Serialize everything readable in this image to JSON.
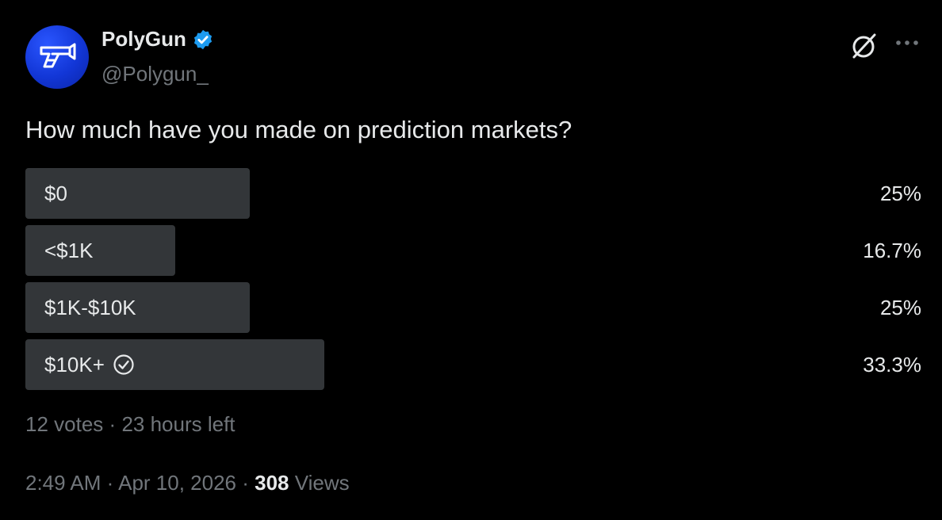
{
  "author": {
    "display_name": "PolyGun",
    "handle": "@Polygun_",
    "verified_icon": "verified-badge-icon",
    "avatar_icon": "polygun-logo",
    "avatar_color": "#1d3fe0"
  },
  "header_actions": {
    "grok_icon": "grok-icon",
    "more_icon": "more-horizontal-icon"
  },
  "post": {
    "question": "How much have you made on prediction markets?"
  },
  "poll": {
    "options": [
      {
        "label": "$0",
        "percent": "25%",
        "share": 0.25,
        "selected": false
      },
      {
        "label": "<$1K",
        "percent": "16.7%",
        "share": 0.167,
        "selected": false
      },
      {
        "label": "$1K-$10K",
        "percent": "25%",
        "share": 0.25,
        "selected": false
      },
      {
        "label": "$10K+",
        "percent": "33.3%",
        "share": 0.333,
        "selected": true
      }
    ],
    "votes": "12 votes",
    "separator": "·",
    "time_left": "23 hours left",
    "bar_color": "#333639"
  },
  "meta": {
    "time": "2:49 AM",
    "separator": "·",
    "date": "Apr 10, 2026",
    "views_count": "308",
    "views_label": "Views"
  },
  "colors": {
    "background": "#000000",
    "primary_text": "#e7e9ea",
    "secondary_text": "#71767b",
    "verified_blue": "#1d9bf0"
  }
}
